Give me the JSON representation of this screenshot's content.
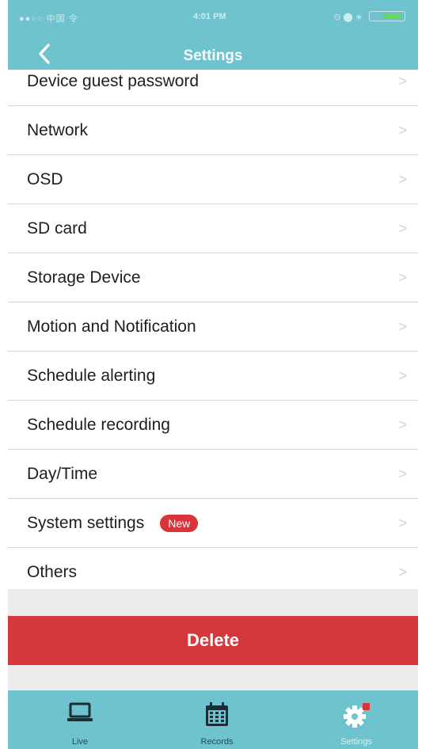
{
  "status_bar": {
    "carrier": "●●○○ 中国 令",
    "time": "4:01 PM",
    "icons": "⊙ ⬤ ∗"
  },
  "header": {
    "title": "Settings"
  },
  "settings_items": [
    {
      "label": "Device guest password"
    },
    {
      "label": "Network"
    },
    {
      "label": "OSD"
    },
    {
      "label": "SD card"
    },
    {
      "label": "Storage Device"
    },
    {
      "label": "Motion and Notification"
    },
    {
      "label": "Schedule alerting"
    },
    {
      "label": "Schedule recording"
    },
    {
      "label": "Day/Time"
    },
    {
      "label": "System settings",
      "badge": "New"
    },
    {
      "label": "Others"
    }
  ],
  "chevron": ">",
  "delete_button": {
    "label": "Delete"
  },
  "tabs": [
    {
      "label": "Live",
      "icon": "laptop-icon"
    },
    {
      "label": "Records",
      "icon": "calendar-icon"
    },
    {
      "label": "Settings",
      "icon": "gear-icon"
    }
  ],
  "colors": {
    "header": "#6ec3cf",
    "delete": "#d5373d",
    "badge": "#d9343a"
  }
}
